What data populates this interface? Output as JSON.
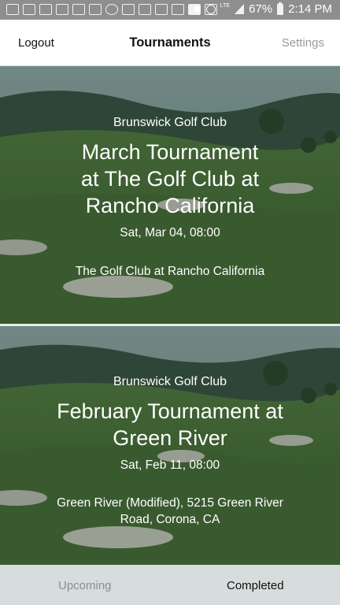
{
  "status_bar": {
    "battery": "67%",
    "time": "2:14 PM",
    "network": "LTE",
    "icons": [
      "chat-icon",
      "calendar-icon",
      "news-icon",
      "mail-icon",
      "mail-icon",
      "mail-icon",
      "slack-icon",
      "calendar-icon",
      "instagram-icon",
      "image-icon",
      "mail-icon",
      "close-box-icon",
      "image-icon",
      "bluetooth-icon",
      "alarm-icon",
      "signal-icon",
      "battery-icon"
    ]
  },
  "nav": {
    "left": "Logout",
    "title": "Tournaments",
    "right": "Settings"
  },
  "tournaments": [
    {
      "club": "Brunswick Golf Club",
      "title_lines": [
        "March Tournament",
        "at The Golf Club at",
        "Rancho California"
      ],
      "date": "Sat, Mar 04, 08:00",
      "venue_lines": [
        "The Golf Club at Rancho California"
      ]
    },
    {
      "club": "Brunswick Golf Club",
      "title_lines": [
        "February Tournament at",
        "Green River"
      ],
      "date": "Sat, Feb 11, 08:00",
      "venue_lines": [
        "Green River (Modified), 5215 Green River",
        "Road, Corona, CA"
      ]
    }
  ],
  "tabs": {
    "upcoming": "Upcoming",
    "completed": "Completed"
  },
  "colors": {
    "status_bar": "#8e8e8e",
    "tab_bar": "#d7dcdc",
    "inactive_tab": "#8a9090",
    "settings_text": "#9a9a9a"
  }
}
